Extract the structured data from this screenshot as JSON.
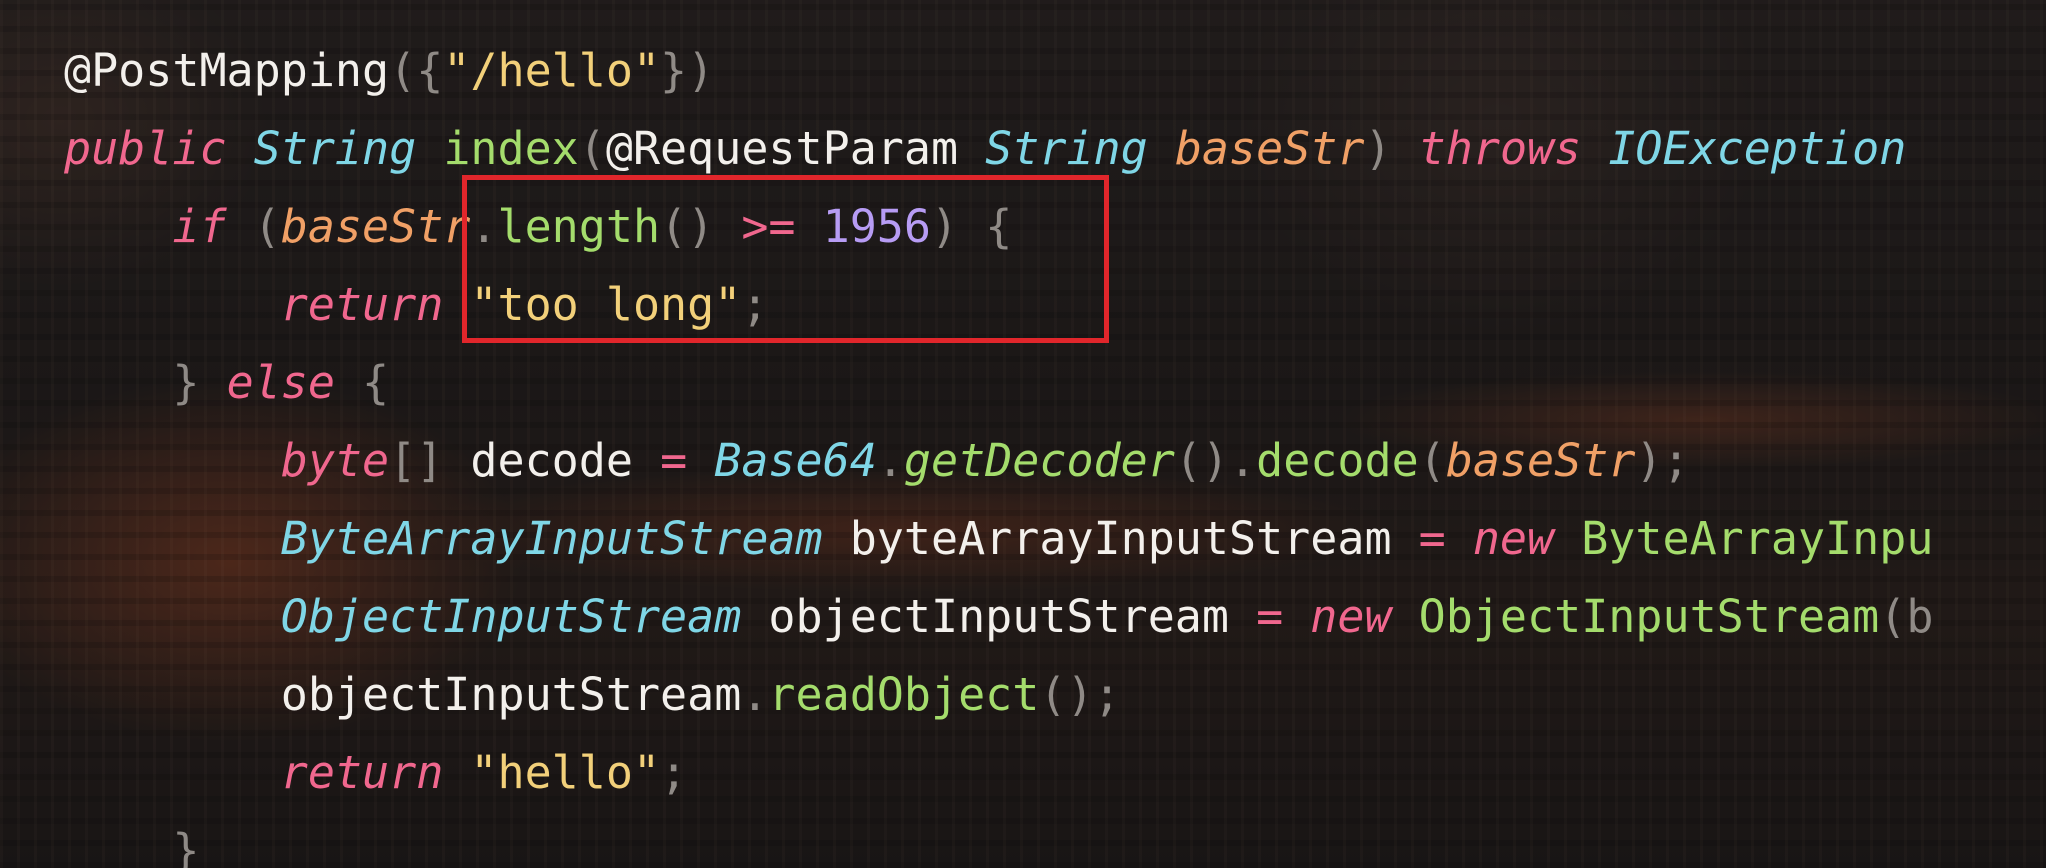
{
  "code_lines": [
    [
      {
        "t": "@PostMapping",
        "c": "ann"
      },
      {
        "t": "({",
        "c": "punc"
      },
      {
        "t": "\"/hello\"",
        "c": "str"
      },
      {
        "t": "})",
        "c": "punc"
      }
    ],
    [
      {
        "t": "public",
        "c": "kw"
      },
      {
        "t": " ",
        "c": "idn"
      },
      {
        "t": "String",
        "c": "typ"
      },
      {
        "t": " ",
        "c": "idn"
      },
      {
        "t": "index",
        "c": "fn"
      },
      {
        "t": "(",
        "c": "punc"
      },
      {
        "t": "@RequestParam",
        "c": "ann"
      },
      {
        "t": " ",
        "c": "idn"
      },
      {
        "t": "String",
        "c": "typ"
      },
      {
        "t": " ",
        "c": "idn"
      },
      {
        "t": "baseStr",
        "c": "par"
      },
      {
        "t": ")",
        "c": "punc"
      },
      {
        "t": " ",
        "c": "idn"
      },
      {
        "t": "throws",
        "c": "kw"
      },
      {
        "t": " ",
        "c": "idn"
      },
      {
        "t": "IOException",
        "c": "typ"
      }
    ],
    [
      {
        "t": "    ",
        "c": "idn"
      },
      {
        "t": "if",
        "c": "kw"
      },
      {
        "t": " ",
        "c": "idn"
      },
      {
        "t": "(",
        "c": "punc"
      },
      {
        "t": "baseStr",
        "c": "par"
      },
      {
        "t": ".",
        "c": "punc"
      },
      {
        "t": "length",
        "c": "fn"
      },
      {
        "t": "()",
        "c": "punc"
      },
      {
        "t": " ",
        "c": "idn"
      },
      {
        "t": ">=",
        "c": "op"
      },
      {
        "t": " ",
        "c": "idn"
      },
      {
        "t": "1956",
        "c": "num"
      },
      {
        "t": ")",
        "c": "punc"
      },
      {
        "t": " ",
        "c": "idn"
      },
      {
        "t": "{",
        "c": "punc"
      }
    ],
    [
      {
        "t": "        ",
        "c": "idn"
      },
      {
        "t": "return",
        "c": "kw"
      },
      {
        "t": " ",
        "c": "idn"
      },
      {
        "t": "\"too long\"",
        "c": "str"
      },
      {
        "t": ";",
        "c": "punc"
      }
    ],
    [
      {
        "t": "    ",
        "c": "idn"
      },
      {
        "t": "}",
        "c": "punc"
      },
      {
        "t": " ",
        "c": "idn"
      },
      {
        "t": "else",
        "c": "kw"
      },
      {
        "t": " ",
        "c": "idn"
      },
      {
        "t": "{",
        "c": "punc"
      }
    ],
    [
      {
        "t": "        ",
        "c": "idn"
      },
      {
        "t": "byte",
        "c": "kw"
      },
      {
        "t": "[]",
        "c": "punc"
      },
      {
        "t": " ",
        "c": "idn"
      },
      {
        "t": "decode",
        "c": "idn"
      },
      {
        "t": " ",
        "c": "idn"
      },
      {
        "t": "=",
        "c": "op"
      },
      {
        "t": " ",
        "c": "idn"
      },
      {
        "t": "Base64",
        "c": "typ"
      },
      {
        "t": ".",
        "c": "punc"
      },
      {
        "t": "getDecoder",
        "c": "fni"
      },
      {
        "t": "()",
        "c": "punc"
      },
      {
        "t": ".",
        "c": "punc"
      },
      {
        "t": "decode",
        "c": "fn"
      },
      {
        "t": "(",
        "c": "punc"
      },
      {
        "t": "baseStr",
        "c": "par"
      },
      {
        "t": ");",
        "c": "punc"
      }
    ],
    [
      {
        "t": "        ",
        "c": "idn"
      },
      {
        "t": "ByteArrayInputStream",
        "c": "typ"
      },
      {
        "t": " ",
        "c": "idn"
      },
      {
        "t": "byteArrayInputStream",
        "c": "idn"
      },
      {
        "t": " ",
        "c": "idn"
      },
      {
        "t": "=",
        "c": "op"
      },
      {
        "t": " ",
        "c": "idn"
      },
      {
        "t": "new",
        "c": "kw"
      },
      {
        "t": " ",
        "c": "idn"
      },
      {
        "t": "ByteArrayInpu",
        "c": "fn"
      }
    ],
    [
      {
        "t": "        ",
        "c": "idn"
      },
      {
        "t": "ObjectInputStream",
        "c": "typ"
      },
      {
        "t": " ",
        "c": "idn"
      },
      {
        "t": "objectInputStream",
        "c": "idn"
      },
      {
        "t": " ",
        "c": "idn"
      },
      {
        "t": "=",
        "c": "op"
      },
      {
        "t": " ",
        "c": "idn"
      },
      {
        "t": "new",
        "c": "kw"
      },
      {
        "t": " ",
        "c": "idn"
      },
      {
        "t": "ObjectInputStream",
        "c": "fn"
      },
      {
        "t": "(b",
        "c": "punc"
      }
    ],
    [
      {
        "t": "        ",
        "c": "idn"
      },
      {
        "t": "objectInputStream",
        "c": "idn"
      },
      {
        "t": ".",
        "c": "punc"
      },
      {
        "t": "readObject",
        "c": "fn"
      },
      {
        "t": "();",
        "c": "punc"
      }
    ],
    [
      {
        "t": "        ",
        "c": "idn"
      },
      {
        "t": "return",
        "c": "kw"
      },
      {
        "t": " ",
        "c": "idn"
      },
      {
        "t": "\"hello\"",
        "c": "str"
      },
      {
        "t": ";",
        "c": "punc"
      }
    ],
    [
      {
        "t": "    ",
        "c": "idn"
      },
      {
        "t": "}",
        "c": "punc"
      }
    ]
  ]
}
